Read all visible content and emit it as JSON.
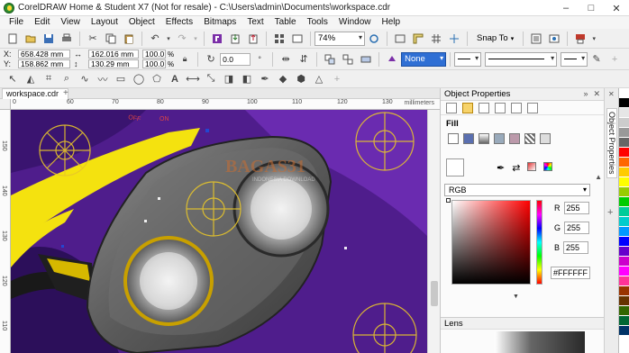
{
  "window": {
    "title": "CorelDRAW Home & Student X7 (Not for resale) - C:\\Users\\admin\\Documents\\workspace.cdr",
    "controls": [
      "–",
      "□",
      "✕"
    ]
  },
  "menu": [
    "File",
    "Edit",
    "View",
    "Layout",
    "Object",
    "Effects",
    "Bitmaps",
    "Text",
    "Table",
    "Tools",
    "Window",
    "Help"
  ],
  "toolbar_standard": {
    "zoom": "74%",
    "snap_to": "Snap To"
  },
  "property_bar": {
    "x": "658.428 mm",
    "y": "158.862 mm",
    "width": "162.016 mm",
    "height": "130.29 mm",
    "scale_w": "100.0",
    "scale_h": "100.0",
    "pct": "%",
    "angle": "0.0",
    "fill_none": "None"
  },
  "document": {
    "tab": "workspace.cdr",
    "ruler_unit": "millimeters",
    "ruler_h_ticks": [
      "0",
      "60",
      "70",
      "80",
      "90",
      "100",
      "110",
      "120",
      "130"
    ],
    "ruler_v_ticks": [
      "150",
      "140",
      "130",
      "120",
      "110",
      "100"
    ]
  },
  "object_properties": {
    "panel_title": "Object Properties",
    "fill_label": "Fill",
    "color_model": "RGB",
    "r_label": "R",
    "g_label": "G",
    "b_label": "B",
    "r": "255",
    "g": "255",
    "b": "255",
    "hex": "#FFFFFF",
    "lens_label": "Lens",
    "dock_tab": "Object Properties"
  },
  "watermark": {
    "brand": "BAGAS31",
    "tagline": "INDONESIA DOWNLOAD"
  },
  "palette_colors": [
    "#ffffff",
    "#000000",
    "#e6e6e6",
    "#cccccc",
    "#999999",
    "#666666",
    "#ff0000",
    "#ff6600",
    "#ffcc00",
    "#ffff00",
    "#99cc00",
    "#00cc00",
    "#00cc99",
    "#00cccc",
    "#0099ff",
    "#0000ff",
    "#6600cc",
    "#cc00cc",
    "#ff00ff",
    "#ff3399",
    "#993300",
    "#663300",
    "#336600",
    "#006633",
    "#003366"
  ]
}
